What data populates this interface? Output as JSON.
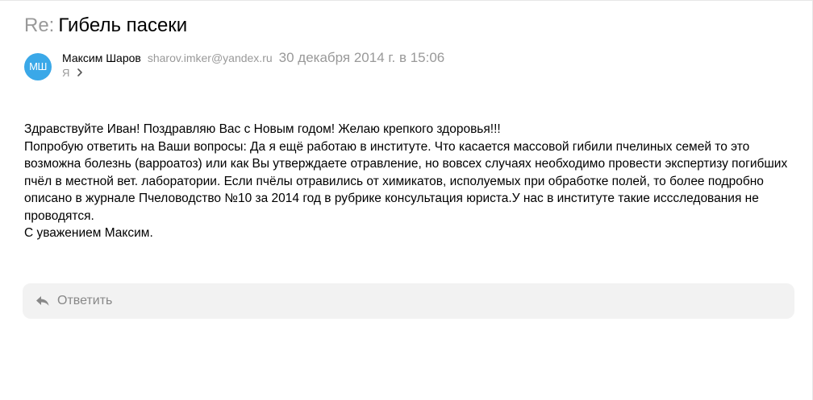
{
  "message": {
    "subject_prefix": "Re:",
    "subject": "Гибель пасеки",
    "sender": {
      "initials": "МШ",
      "name": "Максим Шаров",
      "email": "sharov.imker@yandex.ru",
      "avatar_color": "#3aa8e8"
    },
    "date": "30 декабря 2014 г. в 15:06",
    "recipient": "Я",
    "body": [
      "Здравствуйте Иван! Поздравляю Вас с Новым годом! Желаю крепкого здоровья!!!",
      "Попробую ответить на Ваши вопросы: Да я ещё работаю в институте. Что касается массовой гибили пчелиных семей то это возможна болезнь (варроатоз) или как Вы утверждаете отравление, но вовсех случаях необходимо провести экспертизу погибших пчёл в местной вет. лаборатории. Если пчёлы отравились от химикатов, исполуемых при обработке полей, то более подробно описано в журнале Пчеловодство №10 за 2014 год в рубрике консультация юриста.У нас в институте такие иссследования не проводятся.",
      "С уважением Максим."
    ]
  },
  "reply": {
    "label": "Ответить",
    "icon": "reply-arrow-icon"
  },
  "icons": {
    "recipient_expand": "chevron-right-icon"
  },
  "colors": {
    "muted_text": "#999999",
    "reply_bar_bg": "#f2f2f2",
    "reply_label": "#888888"
  }
}
